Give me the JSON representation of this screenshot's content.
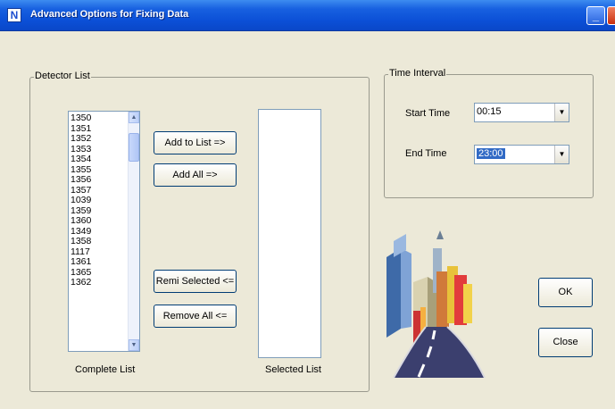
{
  "window": {
    "title": "Advanced Options for Fixing Data",
    "app_icon": "N",
    "title_buttons": [
      "minimize-button",
      "close-button"
    ]
  },
  "detector_group": {
    "legend": "Detector List",
    "complete_list": {
      "items": [
        "1350",
        "1351",
        "1352",
        "1353",
        "1354",
        "1355",
        "1356",
        "1357",
        "1039",
        "1359",
        "1360",
        "1349",
        "1358",
        "1117",
        "1361",
        "1365",
        "1362"
      ],
      "caption": "Complete List"
    },
    "buttons": {
      "add_to_list": "Add to List =>",
      "add_all": "Add All    =>",
      "remove_selected": "Remi Selected <=",
      "remove_all": "Remove All    <="
    },
    "selected_list": {
      "items": [],
      "caption": "Selected List"
    }
  },
  "time_group": {
    "legend": "Time Interval",
    "start_time": {
      "label": "Start Time",
      "value": "00:15"
    },
    "end_time": {
      "label": "End Time",
      "value": "23:00"
    }
  },
  "actions": {
    "ok": "OK",
    "close": "Close"
  },
  "colors": {
    "title_bar": "#0b4fd6",
    "dialog_bg": "#ece9d8",
    "selection": "#316ac5"
  }
}
